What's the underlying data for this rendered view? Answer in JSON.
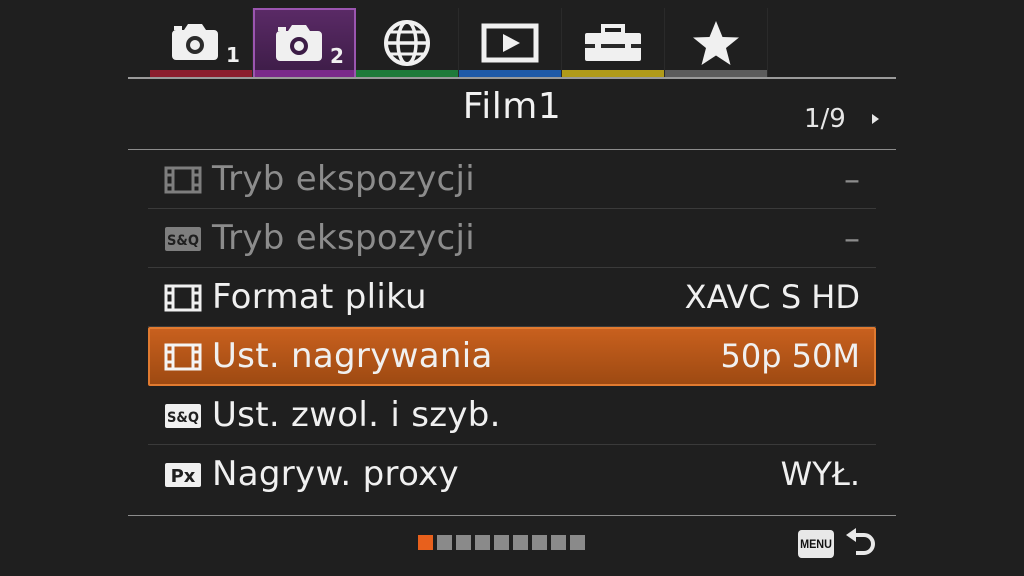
{
  "tabs": [
    {
      "icon": "camera-1-icon",
      "bar_color": "#8b1e2e"
    },
    {
      "icon": "camera-2-icon",
      "bar_color": "#7a2a8a",
      "active": true,
      "number": "2"
    },
    {
      "icon": "globe-icon",
      "bar_color": "#1f7a3a"
    },
    {
      "icon": "playback-icon",
      "bar_color": "#1f5aa8"
    },
    {
      "icon": "toolbox-icon",
      "bar_color": "#b09a1a"
    },
    {
      "icon": "star-icon",
      "bar_color": "#5c5c5c"
    }
  ],
  "tab_numbers": {
    "tab1": "1",
    "tab2": "2"
  },
  "header": {
    "title": "Film1",
    "page": "1/9"
  },
  "items": [
    {
      "icon": "movie-icon",
      "label": "Tryb ekspozycji",
      "value": "–",
      "state": "disabled"
    },
    {
      "icon": "sq-icon",
      "label": "Tryb ekspozycji",
      "value": "–",
      "state": "disabled"
    },
    {
      "icon": "movie-icon",
      "label": "Format pliku",
      "value": "XAVC S HD",
      "state": "normal"
    },
    {
      "icon": "movie-icon",
      "label": "Ust. nagrywania",
      "value": "50p 50M",
      "state": "selected"
    },
    {
      "icon": "sq-icon",
      "label": "Ust. zwol. i szyb.",
      "value": "",
      "state": "normal"
    },
    {
      "icon": "px-icon",
      "label": "Nagryw. proxy",
      "value": "WYŁ.",
      "state": "normal"
    }
  ],
  "icon_text": {
    "sq": "S&Q",
    "px": "Px"
  },
  "pagination": {
    "current": 1,
    "total": 9
  },
  "footer": {
    "menu_label": "MENU"
  },
  "colors": {
    "accent": "#e8601c",
    "selected_row": "#b5561a"
  }
}
